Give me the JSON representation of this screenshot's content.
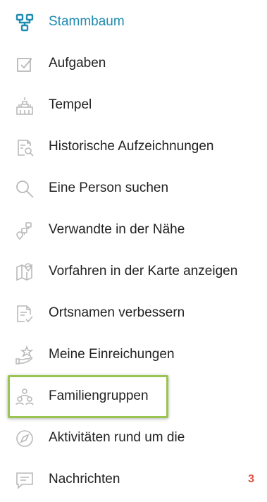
{
  "menu": {
    "items": [
      {
        "label": "Stammbaum",
        "icon": "family-tree-icon",
        "active": true
      },
      {
        "label": "Aufgaben",
        "icon": "checklist-icon"
      },
      {
        "label": "Tempel",
        "icon": "temple-icon"
      },
      {
        "label": "Historische Aufzeichnungen",
        "icon": "record-search-icon"
      },
      {
        "label": "Eine Person suchen",
        "icon": "search-icon"
      },
      {
        "label": "Verwandte in der Nähe",
        "icon": "relatives-nearby-icon"
      },
      {
        "label": "Vorfahren in der Karte anzeigen",
        "icon": "map-pin-icon"
      },
      {
        "label": "Ortsnamen verbessern",
        "icon": "document-check-icon"
      },
      {
        "label": "Meine Einreichungen",
        "icon": "hand-star-icon"
      },
      {
        "label": "Familiengruppen",
        "icon": "group-icon",
        "highlighted": true
      },
      {
        "label": "Aktivitäten rund um die",
        "icon": "compass-icon"
      },
      {
        "label": "Nachrichten",
        "icon": "message-icon",
        "badge": "3"
      }
    ]
  },
  "colors": {
    "accent": "#1f8bb0",
    "icon_gray": "#b9b9b9",
    "badge": "#e0533f",
    "highlight_border": "#9bc552"
  }
}
